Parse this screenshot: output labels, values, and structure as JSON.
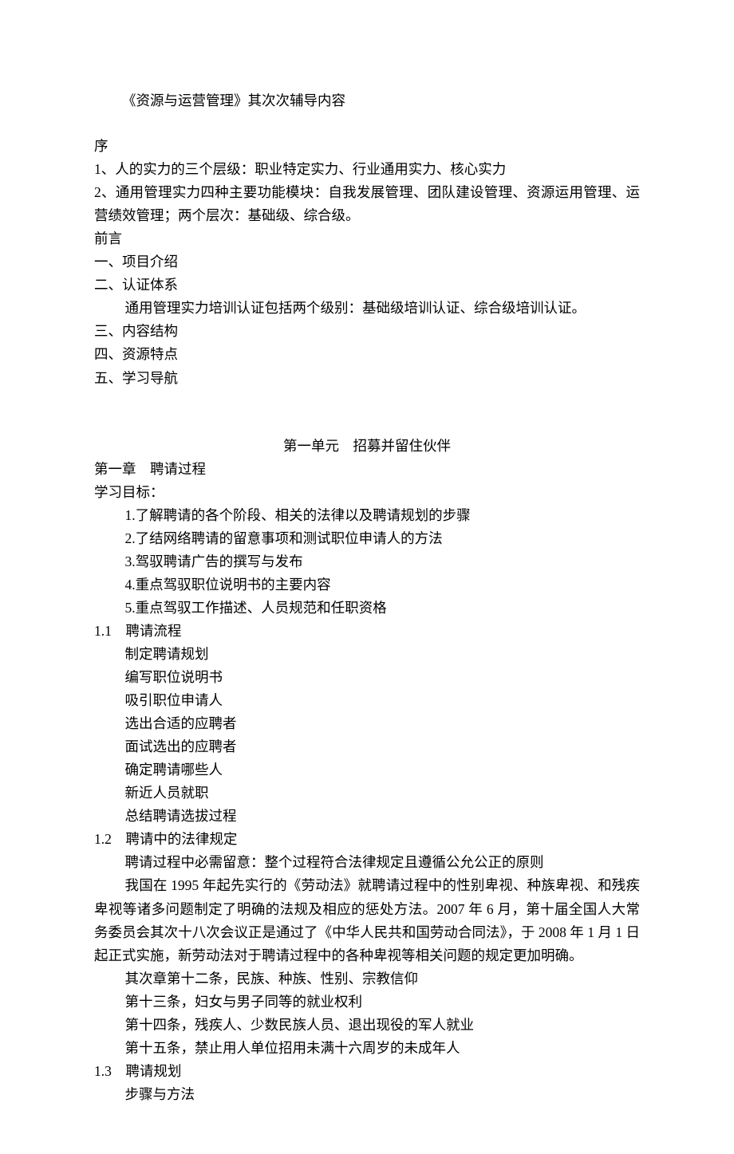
{
  "doc": {
    "title": "《资源与运营管理》其次次辅导内容",
    "preface_label": "序",
    "preface_items": [
      "1、人的实力的三个层级：职业特定实力、行业通用实力、核心实力",
      "2、通用管理实力四种主要功能模块：自我发展管理、团队建设管理、资源运用管理、运营绩效管理；两个层次：基础级、综合级。"
    ],
    "foreword_label": "前言",
    "foreword_items": [
      "一、项目介绍",
      "二、认证体系"
    ],
    "foreword_sub": "通用管理实力培训认证包括两个级别：基础级培训认证、综合级培训认证。",
    "foreword_items2": [
      "三、内容结构",
      "四、资源特点",
      "五、学习导航"
    ],
    "unit1_title": "第一单元　招募并留住伙伴",
    "chapter1_title": "第一章　聘请过程",
    "goals_label": "学习目标：",
    "goals": [
      "1.了解聘请的各个阶段、相关的法律以及聘请规划的步骤",
      "2.了结网络聘请的留意事项和测试职位申请人的方法",
      "3.驾驭聘请广告的撰写与发布",
      "4.重点驾驭职位说明书的主要内容",
      "5.重点驾驭工作描述、人员规范和任职资格"
    ],
    "s11_title": "1.1　聘请流程",
    "s11_items": [
      "制定聘请规划",
      "编写职位说明书",
      "吸引职位申请人",
      "选出合适的应聘者",
      "面试选出的应聘者",
      "确定聘请哪些人",
      "新近人员就职",
      "总结聘请选拔过程"
    ],
    "s12_title": "1.2　聘请中的法律规定",
    "s12_p1": "聘请过程中必需留意：整个过程符合法律规定且遵循公允公正的原则",
    "s12_p2": "我国在 1995 年起先实行的《劳动法》就聘请过程中的性别卑视、种族卑视、和残疾卑视等诸多问题制定了明确的法规及相应的惩处方法。2007 年 6 月，第十届全国人大常务委员会其次十八次会议正是通过了《中华人民共和国劳动合同法》，于 2008 年 1 月 1 日起正式实施，新劳动法对于聘请过程中的各种卑视等相关问题的规定更加明确。",
    "s12_items": [
      "其次章第十二条，民族、种族、性别、宗教信仰",
      "第十三条，妇女与男子同等的就业权利",
      "第十四条，残疾人、少数民族人员、退出现役的军人就业",
      "第十五条，禁止用人单位招用未满十六周岁的未成年人"
    ],
    "s13_title": "1.3　聘请规划",
    "s13_item": "步骤与方法"
  }
}
